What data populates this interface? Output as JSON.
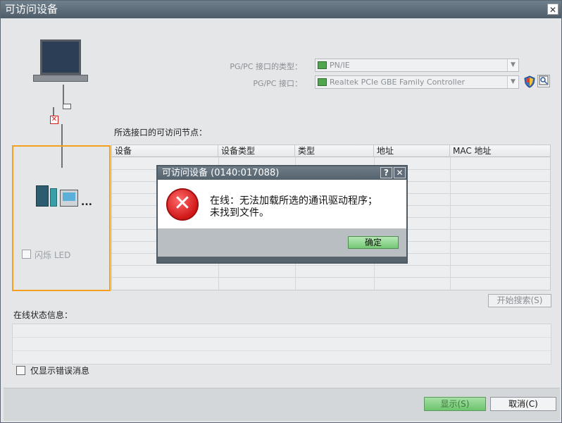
{
  "window": {
    "title": "可访问设备",
    "close_glyph": "✕"
  },
  "interface": {
    "type_label": "PG/PC 接口的类型：",
    "type_value": "PN/IE",
    "iface_label": "PG/PC 接口：",
    "iface_value": "Realtek PCIe GBE Family Controller"
  },
  "flash_led_label": "闪烁 LED",
  "nodes_label": "所选接口的可访问节点：",
  "table": {
    "columns": [
      "设备",
      "设备类型",
      "类型",
      "地址",
      "MAC 地址"
    ]
  },
  "search_button": "开始搜索(S)",
  "online_status_label": "在线状态信息：",
  "only_errors_label": "仅显示错误消息",
  "footer": {
    "show_button": "显示(S)",
    "cancel_button": "取消(C)"
  },
  "dialog": {
    "title": "可访问设备 (0140:017088)",
    "help_glyph": "?",
    "close_glyph": "✕",
    "message_line1": "在线：无法加载所选的通讯驱动程序；",
    "message_line2": "未找到文件。",
    "ok_button": "确定"
  },
  "colors": {
    "accent_orange": "#f5a020",
    "error_red": "#d01818",
    "green_button": "#74c874"
  }
}
